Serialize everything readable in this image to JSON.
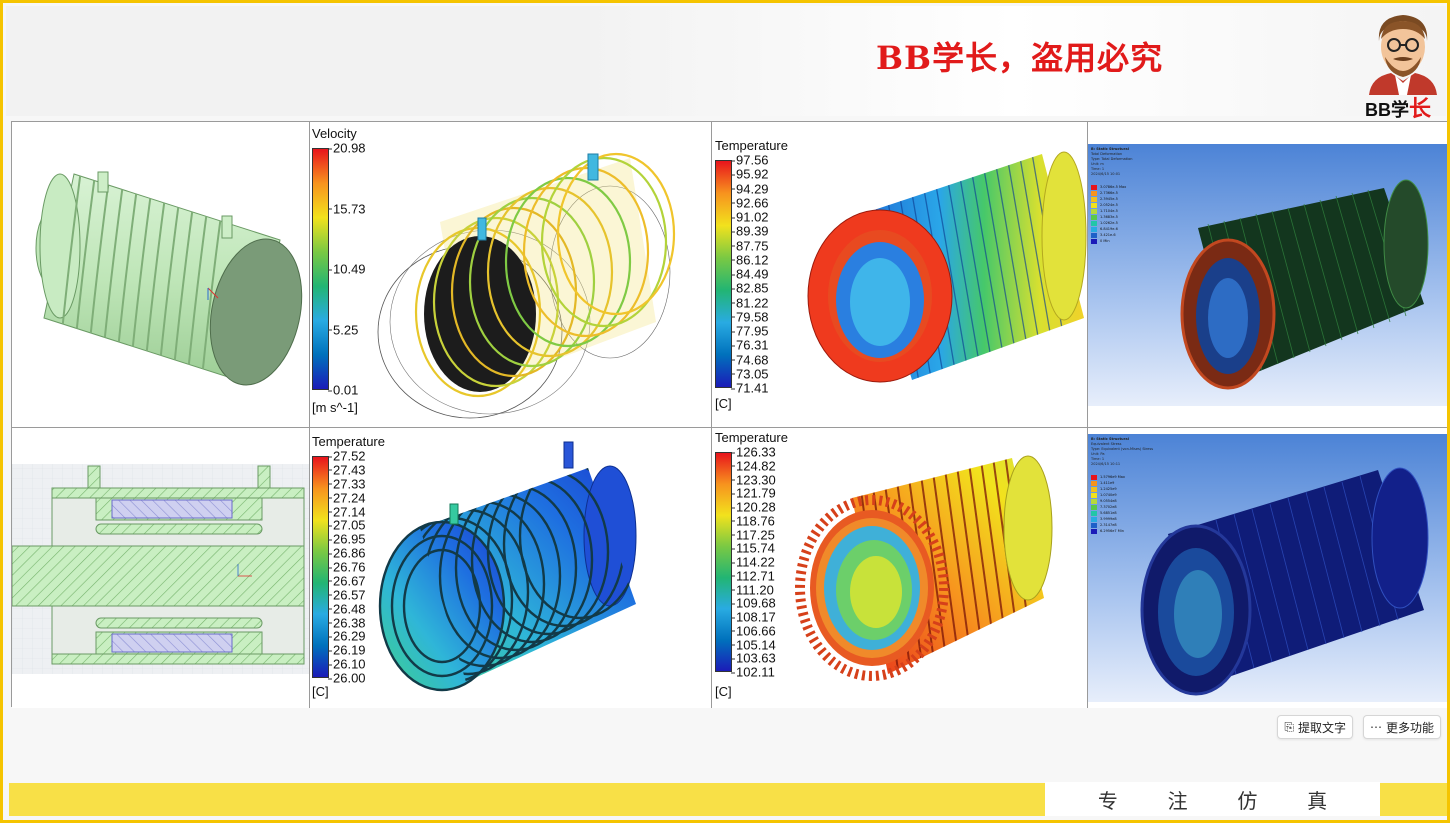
{
  "header": {
    "watermark": "BB学长，盗用必究",
    "logo_text_a": "BB学",
    "logo_text_b": "长"
  },
  "colors": {
    "accent_yellow": "#f5c400",
    "watermark_red": "#e11a1a"
  },
  "cells": {
    "r1c2": {
      "legend": {
        "title": "Velocity",
        "unit": "[m s^-1]",
        "ticks": [
          "20.98",
          "15.73",
          "10.49",
          "5.25",
          "0.01"
        ]
      }
    },
    "r1c3": {
      "legend": {
        "title": "Temperature",
        "unit": "[C]",
        "ticks": [
          "97.56",
          "95.92",
          "94.29",
          "92.66",
          "91.02",
          "89.39",
          "87.75",
          "86.12",
          "84.49",
          "82.85",
          "81.22",
          "79.58",
          "77.95",
          "76.31",
          "74.68",
          "73.05",
          "71.41"
        ]
      }
    },
    "r1c4": {
      "header": [
        "B: Static Structural",
        "Total Deformation",
        "Type: Total Deformation",
        "Unit: m",
        "Time: 1",
        "2024/6/15 10:01"
      ],
      "legend": [
        "3.0786e-5 Max",
        "2.7366e-5",
        "2.3945e-5",
        "2.0524e-5",
        "1.7104e-5",
        "1.3683e-5",
        "1.0262e-5",
        "6.8419e-6",
        "3.421e-6",
        "0 Min"
      ]
    },
    "r2c2": {
      "legend": {
        "title": "Temperature",
        "unit": "[C]",
        "ticks": [
          "27.52",
          "27.43",
          "27.33",
          "27.24",
          "27.14",
          "27.05",
          "26.95",
          "26.86",
          "26.76",
          "26.67",
          "26.57",
          "26.48",
          "26.38",
          "26.29",
          "26.19",
          "26.10",
          "26.00"
        ]
      }
    },
    "r2c3": {
      "legend": {
        "title": "Temperature",
        "unit": "[C]",
        "ticks": [
          "126.33",
          "124.82",
          "123.30",
          "121.79",
          "120.28",
          "118.76",
          "117.25",
          "115.74",
          "114.22",
          "112.71",
          "111.20",
          "109.68",
          "108.17",
          "106.66",
          "105.14",
          "103.63",
          "102.11"
        ]
      }
    },
    "r2c4": {
      "header": [
        "B: Static Structural",
        "Equivalent Stress",
        "Type: Equivalent (von-Mises) Stress",
        "Unit: Pa",
        "Time: 1",
        "2024/6/15 10:11"
      ],
      "legend": [
        "1.5796e9 Max",
        "1.411e9",
        "1.2425e9",
        "1.0740e9",
        "9.0554e8",
        "7.3702e8",
        "5.6851e8",
        "3.9999e8",
        "2.3147e8",
        "6.2956e7 Min"
      ]
    }
  },
  "buttons": {
    "extract_text": "提取文字",
    "more": "更多功能"
  },
  "footer": {
    "chars": [
      "专",
      "注",
      "仿",
      "真"
    ]
  }
}
